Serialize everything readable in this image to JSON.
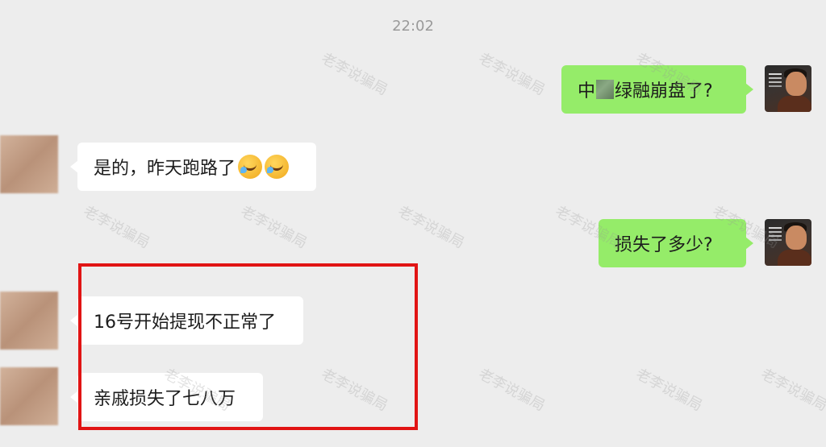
{
  "timestamp": "22:02",
  "messages": [
    {
      "from": "self",
      "text_pre": "中",
      "text_post": "绿融崩盘了?"
    },
    {
      "from": "other",
      "text": "是的，昨天跑路了",
      "emoji": [
        "crying-laughing-emoji",
        "crying-laughing-emoji"
      ]
    },
    {
      "from": "self",
      "text": "损失了多少?"
    },
    {
      "from": "other",
      "text": "16号开始提现不正常了"
    },
    {
      "from": "other",
      "text": "亲戚损失了七八万"
    }
  ],
  "watermark": "老李说骗局",
  "colors": {
    "background": "#ededed",
    "outgoing_bubble": "#95ec69",
    "incoming_bubble": "#ffffff",
    "highlight_border": "#e11414"
  }
}
